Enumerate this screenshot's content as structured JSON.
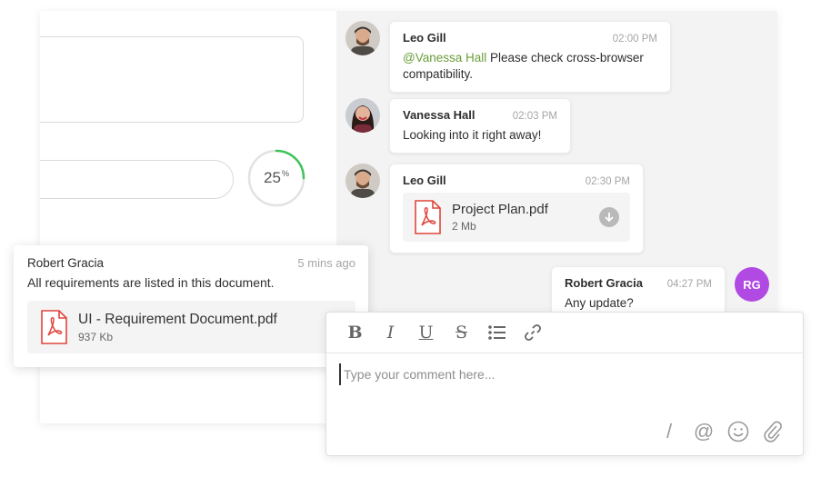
{
  "progress": {
    "value": "25",
    "unit": "%",
    "fraction": 0.25
  },
  "messages": [
    {
      "sender": "Leo Gill",
      "time": "02:00 PM",
      "mention": "@Vanessa Hall",
      "text_after_mention": " Please ",
      "text_bold": "check",
      "text_rest": " cross-browser compatibility."
    },
    {
      "sender": "Vanessa Hall",
      "time": "02:03 PM",
      "text": "Looking into it right away!"
    },
    {
      "sender": "Leo Gill",
      "time": "02:30 PM",
      "file": {
        "name": "Project Plan.pdf",
        "size": "2 Mb"
      }
    },
    {
      "sender": "Robert Gracia",
      "time": "04:27 PM",
      "text": "Any update?",
      "initials": "RG"
    }
  ],
  "float_card": {
    "sender": "Robert Gracia",
    "time": "5 mins ago",
    "text": "All requirements are listed in this document.",
    "file": {
      "name": "UI - Requirement Document.pdf",
      "size": "937 Kb"
    }
  },
  "editor": {
    "toolbar": {
      "bold": "B",
      "italic": "I",
      "underline": "U",
      "strike": "S"
    },
    "placeholder": "Type your comment here...",
    "actions": {
      "slash": "/",
      "mention": "@"
    }
  },
  "colors": {
    "accent_green": "#3ec45a",
    "mention_green": "#6a9d3a",
    "rg_purple": "#b04ae3",
    "pdf_red": "#e0453c"
  }
}
